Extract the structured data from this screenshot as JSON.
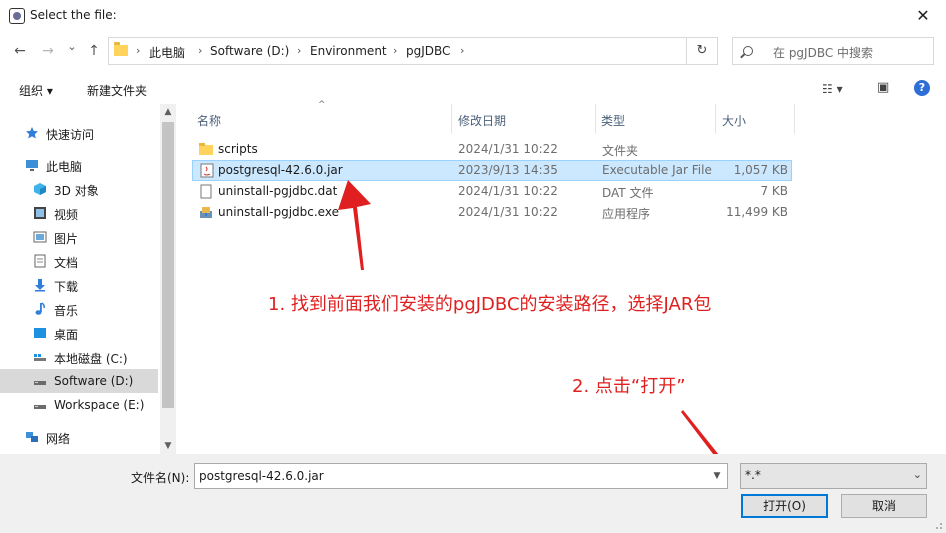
{
  "window": {
    "title": "Select the file:",
    "close_glyph": "✕"
  },
  "nav": {
    "back_glyph": "←",
    "forward_glyph": "→",
    "recent_glyph": "⌄",
    "up_glyph": "↑",
    "breadcrumbs": [
      "此电脑",
      "Software (D:)",
      "Environment",
      "pgJDBC"
    ],
    "crumb_sep": "›",
    "dropdown_glyph": "⌄",
    "refresh_glyph": "↻",
    "search_placeholder": "在 pgJDBC 中搜索"
  },
  "toolbar": {
    "organize_label": "组织 ▾",
    "new_folder_label": "新建文件夹",
    "view_glyph": "☷ ▾",
    "pane_glyph": "▣",
    "help_glyph": "?"
  },
  "sidebar": {
    "items": [
      {
        "label": "快速访问",
        "icon": "star-icon"
      },
      {
        "label": "此电脑",
        "icon": "computer-icon"
      },
      {
        "label": "3D 对象",
        "icon": "cube-icon"
      },
      {
        "label": "视频",
        "icon": "video-icon"
      },
      {
        "label": "图片",
        "icon": "picture-icon"
      },
      {
        "label": "文档",
        "icon": "document-icon"
      },
      {
        "label": "下载",
        "icon": "download-icon"
      },
      {
        "label": "音乐",
        "icon": "music-icon"
      },
      {
        "label": "桌面",
        "icon": "desktop-icon"
      },
      {
        "label": "本地磁盘 (C:)",
        "icon": "windows-drive-icon"
      },
      {
        "label": "Software (D:)",
        "icon": "drive-icon"
      },
      {
        "label": "Workspace (E:)",
        "icon": "drive-icon"
      },
      {
        "label": "网络",
        "icon": "network-icon"
      }
    ]
  },
  "filelist": {
    "columns": [
      "名称",
      "修改日期",
      "类型",
      "大小"
    ],
    "sort_glyph": "^",
    "rows": [
      {
        "name": "scripts",
        "date": "2024/1/31 10:22",
        "type": "文件夹",
        "size": "",
        "icon": "folder-icon"
      },
      {
        "name": "postgresql-42.6.0.jar",
        "date": "2023/9/13 14:35",
        "type": "Executable Jar File",
        "size": "1,057 KB",
        "icon": "jar-file-icon"
      },
      {
        "name": "uninstall-pgjdbc.dat",
        "date": "2024/1/31 10:22",
        "type": "DAT 文件",
        "size": "7 KB",
        "icon": "file-icon"
      },
      {
        "name": "uninstall-pgjdbc.exe",
        "date": "2024/1/31 10:22",
        "type": "应用程序",
        "size": "11,499 KB",
        "icon": "installer-icon"
      }
    ],
    "selected_index": 1
  },
  "annotations": {
    "step1": "1. 找到前面我们安装的pgJDBC的安装路径，选择JAR包",
    "step2": "2. 点击“打开”",
    "color": "#e02020"
  },
  "footer": {
    "filename_label": "文件名(N):",
    "filename_value": "postgresql-42.6.0.jar",
    "filetype_value": "*.*",
    "open_label": "打开(O)",
    "cancel_label": "取消"
  }
}
